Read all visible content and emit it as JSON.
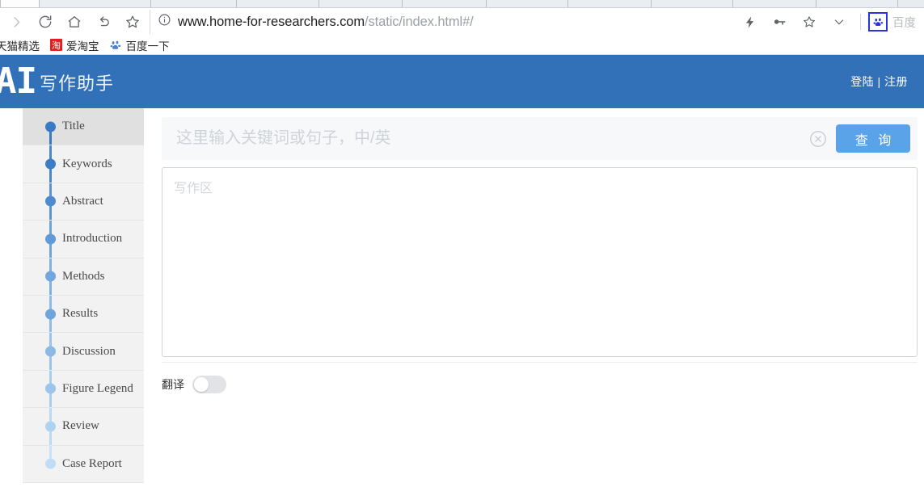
{
  "browser": {
    "tab_count": 11,
    "nav_icons": [
      "forward-icon",
      "reload-icon",
      "home-icon",
      "back-icon",
      "bookmark-star-icon"
    ],
    "url": {
      "host": "www.home-for-researchers.com",
      "path": "/static/index.html#/",
      "security_icon": "info-circle-icon"
    },
    "toolbar_right_icons": [
      "lightning-icon",
      "key-icon",
      "star-icon",
      "chevron-down-icon"
    ],
    "extension": {
      "icon": "baidu-paw-icon",
      "label": "百度"
    },
    "bookmarks": [
      {
        "label": "天猫精选",
        "icon": "none"
      },
      {
        "label": "爱淘宝",
        "icon": "taobao-icon",
        "icon_text": "淘"
      },
      {
        "label": "百度一下",
        "icon": "baidu-paw-icon"
      }
    ]
  },
  "header": {
    "logo_text": "AI",
    "logo_subtitle": "写作助手",
    "auth": "登陆 | 注册",
    "background_color": "#3271b8"
  },
  "sidebar": {
    "items": [
      {
        "label": "Title",
        "active": true,
        "dot_color": "#3a79c4",
        "line_color": "#3a79c4"
      },
      {
        "label": "Keywords",
        "active": false,
        "dot_color": "#3d7cc6",
        "line_color": "#4a87cd"
      },
      {
        "label": "Abstract",
        "active": false,
        "dot_color": "#4d8bd0",
        "line_color": "#5b95d6"
      },
      {
        "label": "Introduction",
        "active": false,
        "dot_color": "#5f9ad9",
        "line_color": "#6ea4dd"
      },
      {
        "label": "Methods",
        "active": false,
        "dot_color": "#72a6de",
        "line_color": "#81b1e3"
      },
      {
        "label": "Results",
        "active": false,
        "dot_color": "#6fa4dd",
        "line_color": "#8fbbe8"
      },
      {
        "label": "Discussion",
        "active": false,
        "dot_color": "#8cb8e6",
        "line_color": "#9cc3ea"
      },
      {
        "label": "Figure Legend",
        "active": false,
        "dot_color": "#9cc4ec",
        "line_color": "#a9cdef"
      },
      {
        "label": "Review",
        "active": false,
        "dot_color": "#aed2f1",
        "line_color": "#badaf4"
      },
      {
        "label": "Case Report",
        "active": false,
        "dot_color": "#c0dcf6",
        "line_color": "#c9e2f8"
      }
    ]
  },
  "main": {
    "search": {
      "value": "",
      "placeholder": "这里输入关键词或句子，中/英",
      "clear_icon": "clear-circle-icon",
      "button_label": "查 询",
      "button_color": "#5aa3e8"
    },
    "editor": {
      "value": "",
      "placeholder": "写作区"
    },
    "translate": {
      "label": "翻译",
      "enabled": false
    }
  }
}
